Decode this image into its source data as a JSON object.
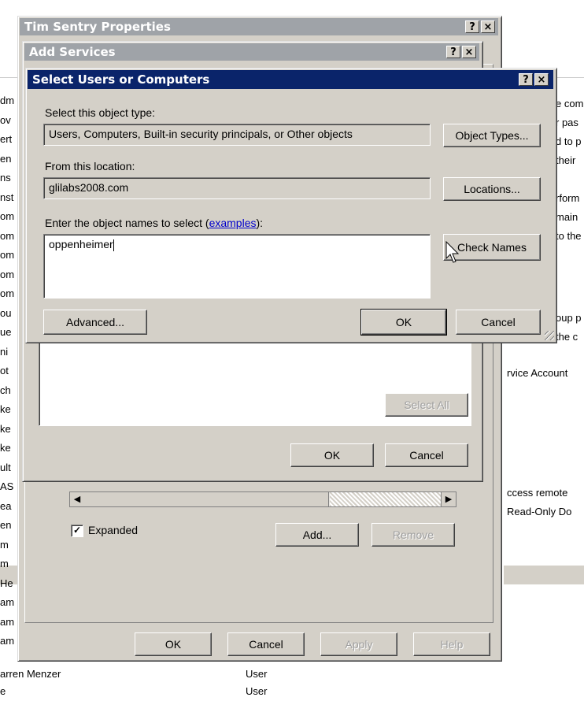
{
  "background": {
    "left_fragments": [
      "dm",
      "ov",
      "ert",
      "en",
      "ns",
      "nst",
      "om",
      "om",
      "om",
      "om",
      "om",
      "ou",
      "ue",
      "ni",
      "ot",
      "ch",
      "ke",
      "ke",
      "ke",
      "ult",
      "AS",
      "ea",
      "en",
      "m",
      "m",
      "He",
      "am",
      "am",
      "am"
    ],
    "right_fragments": [
      "e com",
      "r pas",
      "d to p",
      "their",
      "rform",
      "main",
      "to the",
      "oup p",
      "the c",
      "rvice Account",
      "ccess remote",
      "Read-Only Do"
    ],
    "bottom_rows": [
      {
        "name": "arren Menzer",
        "type": "User"
      },
      {
        "name": "e",
        "type": "User"
      }
    ]
  },
  "properties_window": {
    "title": "Tim Sentry Properties",
    "help_glyph": "?",
    "close_glyph": "×",
    "ok_label": "OK",
    "cancel_label": "Cancel",
    "apply_label": "Apply",
    "help_label": "Help"
  },
  "add_services_window": {
    "title": "Add Services",
    "help_glyph": "?",
    "close_glyph": "×",
    "select_all_label": "Select All",
    "ok_label": "OK",
    "cancel_label": "Cancel",
    "expanded_label": "Expanded",
    "expanded_checked": true,
    "add_label": "Add...",
    "remove_label": "Remove"
  },
  "select_dialog": {
    "title": "Select Users or Computers",
    "help_glyph": "?",
    "close_glyph": "×",
    "object_type_label": "Select this object type:",
    "object_type_value": "Users, Computers, Built-in security principals, or Other objects",
    "object_types_button": "Object Types...",
    "location_label": "From this location:",
    "location_value": "glilabs2008.com",
    "locations_button": "Locations...",
    "names_label_prefix": "Enter the object names to select (",
    "names_label_link": "examples",
    "names_label_suffix": "):",
    "names_value": "oppenheimer",
    "check_names_button": "Check Names",
    "advanced_button": "Advanced...",
    "ok_button": "OK",
    "cancel_button": "Cancel"
  },
  "colors": {
    "dialog_face": "#d4d0c8",
    "active_title": "#0a246a",
    "inactive_title": "#9fa3a8",
    "link": "#0000cc"
  }
}
